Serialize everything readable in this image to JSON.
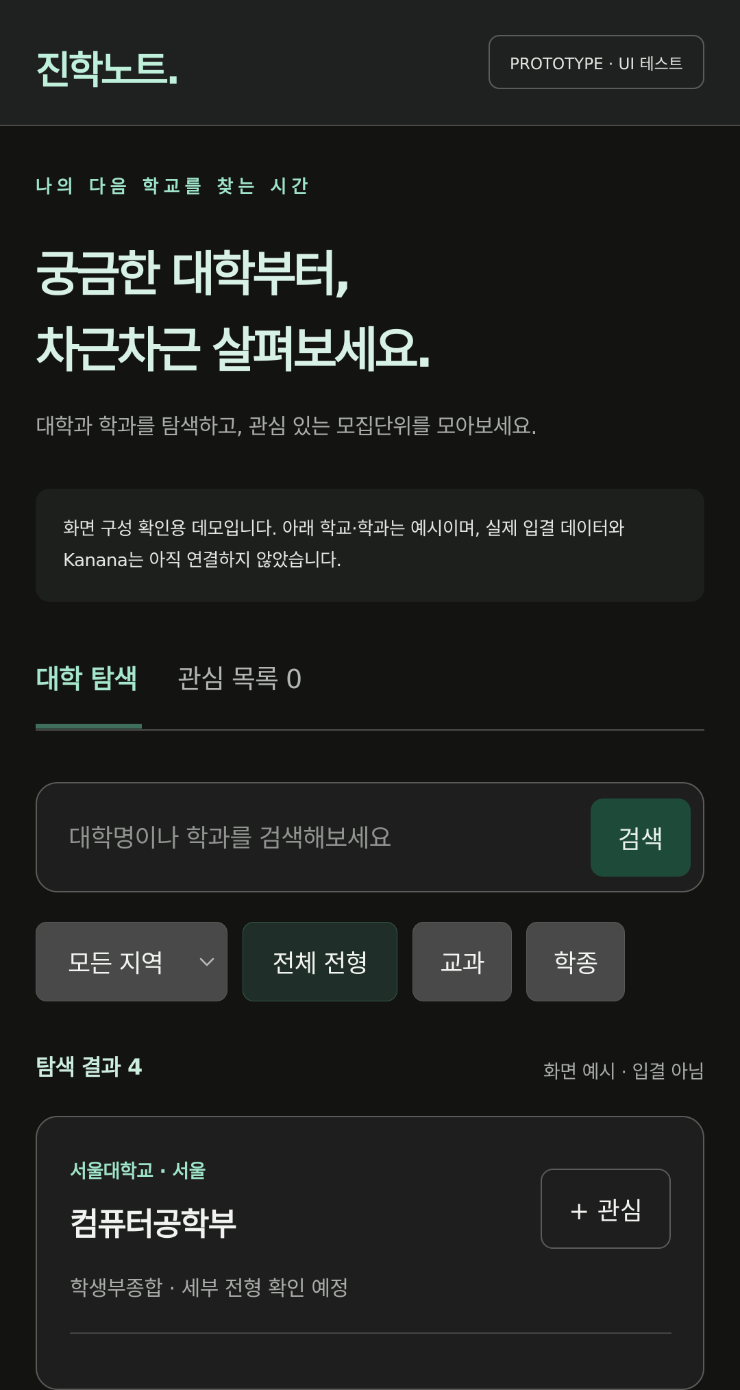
{
  "header": {
    "logo": "진학노트",
    "logo_dot": ".",
    "badge": "PROTOTYPE · UI 테스트"
  },
  "hero": {
    "eyebrow": "나의 다음 학교를 찾는 시간",
    "title_line1": "궁금한 대학부터,",
    "title_line2": "차근차근 살펴보세요.",
    "subtitle": "대학과 학과를 탐색하고, 관심 있는 모집단위를 모아보세요."
  },
  "notice": {
    "text": "화면 구성 확인용 데모입니다. 아래 학교·학과는 예시이며, 실제 입결 데이터와 Kanana는 아직 연결하지 않았습니다."
  },
  "tabs": [
    {
      "label": "대학 탐색",
      "active": true
    },
    {
      "label": "관심 목록 0",
      "active": false
    }
  ],
  "search": {
    "placeholder": "대학명이나 학과를 검색해보세요",
    "value": "",
    "button_label": "검색"
  },
  "filters": {
    "region": "모든 지역",
    "all_types": "전체 전형",
    "subject": "교과",
    "holistic": "학종"
  },
  "results": {
    "title": "탐색 결과 4",
    "meta": "화면 예시 · 입결 아님"
  },
  "cards": [
    {
      "university": "서울대학교 · 서울",
      "major": "컴퓨터공학부",
      "detail": "학생부종합 · 세부 전형 확인 예정",
      "fav_label": "+ 관심"
    }
  ],
  "colors": {
    "accent": "#9fe3c8",
    "brand_dark": "#1e4a3a",
    "background": "#131412",
    "header_bg": "#1f2020"
  },
  "icons": {
    "region_chevron": "chevron-down-icon"
  }
}
